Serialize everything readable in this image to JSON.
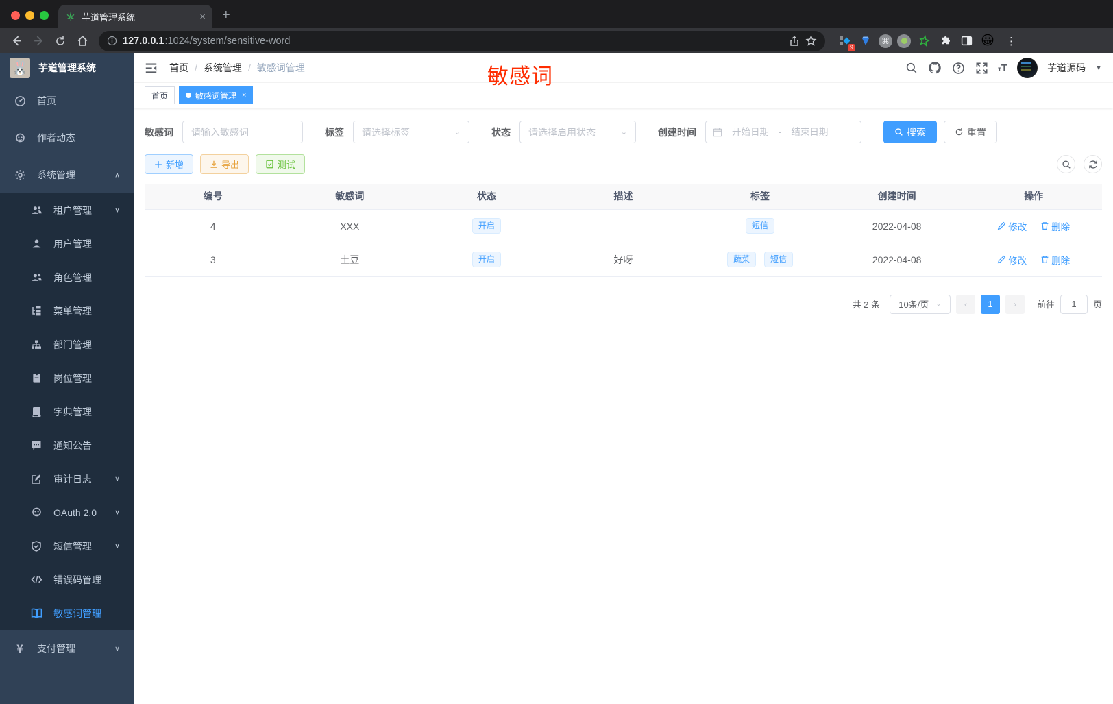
{
  "colors": {
    "accent": "#409eff",
    "annotation_red": "#fe2c00",
    "warning": "#e6a23c",
    "success": "#67c23a",
    "sidebar_bg": "#304156",
    "submenu_bg": "#1f2d3d"
  },
  "browser": {
    "tab_title": "芋道管理系统",
    "tab_close": "×",
    "new_tab": "+",
    "url_host": "127.0.0.1",
    "url_rest": ":1024/system/sensitive-word",
    "ext_badge": "9",
    "kebab": "⋮"
  },
  "sidebar": {
    "title": "芋道管理系统",
    "items": [
      {
        "label": "首页"
      },
      {
        "label": "作者动态"
      },
      {
        "label": "系统管理",
        "arrow": "∧"
      },
      {
        "label": "租户管理",
        "arrow": "∨"
      },
      {
        "label": "用户管理"
      },
      {
        "label": "角色管理"
      },
      {
        "label": "菜单管理"
      },
      {
        "label": "部门管理"
      },
      {
        "label": "岗位管理"
      },
      {
        "label": "字典管理"
      },
      {
        "label": "通知公告"
      },
      {
        "label": "审计日志",
        "arrow": "∨"
      },
      {
        "label": "OAuth 2.0",
        "arrow": "∨"
      },
      {
        "label": "短信管理",
        "arrow": "∨"
      },
      {
        "label": "错误码管理"
      },
      {
        "label": "敏感词管理"
      },
      {
        "label": "支付管理",
        "arrow": "∨"
      }
    ]
  },
  "header": {
    "breadcrumb": [
      "首页",
      "系统管理",
      "敏感词管理"
    ],
    "separator": "/",
    "annotation": "敏感词",
    "username": "芋道源码"
  },
  "tabs": [
    {
      "label": "首页"
    },
    {
      "label": "敏感词管理",
      "close": "×"
    }
  ],
  "filters": {
    "word_label": "敏感词",
    "word_placeholder": "请输入敏感词",
    "tag_label": "标签",
    "tag_placeholder": "请选择标签",
    "status_label": "状态",
    "status_placeholder": "请选择启用状态",
    "date_label": "创建时间",
    "date_start": "开始日期",
    "date_sep": "-",
    "date_end": "结束日期",
    "search_label": "搜索",
    "reset_label": "重置"
  },
  "toolbar": {
    "add_label": "新增",
    "export_label": "导出",
    "test_label": "测试"
  },
  "table": {
    "columns": [
      "编号",
      "敏感词",
      "状态",
      "描述",
      "标签",
      "创建时间",
      "操作"
    ],
    "rows": [
      {
        "id": "4",
        "word": "XXX",
        "status": "开启",
        "desc": "",
        "tags": [
          "短信"
        ],
        "created": "2022-04-08"
      },
      {
        "id": "3",
        "word": "土豆",
        "status": "开启",
        "desc": "好呀",
        "tags": [
          "蔬菜",
          "短信"
        ],
        "created": "2022-04-08"
      }
    ],
    "edit_label": "修改",
    "delete_label": "删除"
  },
  "pagination": {
    "total": "共 2 条",
    "page_size": "10条/页",
    "prev": "‹",
    "next": "›",
    "current_page": "1",
    "goto_label": "前往",
    "goto_value": "1",
    "unit_label": "页"
  }
}
